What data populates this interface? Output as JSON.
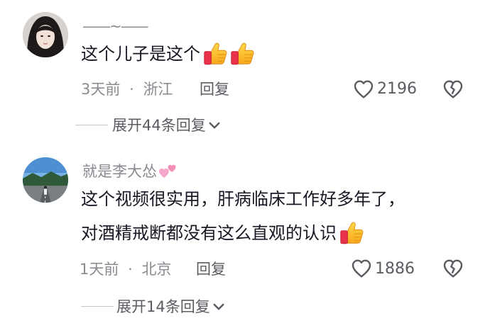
{
  "comments": [
    {
      "username": "——~——",
      "text_lines": [
        "这个儿子是这个"
      ],
      "emojis": [
        "thumbs-up",
        "thumbs-up"
      ],
      "time": "3天前",
      "location": "浙江",
      "reply_label": "回复",
      "like_count": "2196",
      "expand_label": "展开44条回复"
    },
    {
      "username": "就是李大怂",
      "username_emoji": "two-hearts",
      "text_lines": [
        "这个视频很实用，肝病临床工作好多年了，",
        "对酒精戒断都没有这么直观的认识"
      ],
      "emojis": [
        "thumbs-up"
      ],
      "time": "1天前",
      "location": "北京",
      "reply_label": "回复",
      "like_count": "1886",
      "expand_label": "展开14条回复"
    }
  ],
  "colors": {
    "text": "#161823",
    "muted": "#8a8b91",
    "secondary": "#5b5c62"
  }
}
